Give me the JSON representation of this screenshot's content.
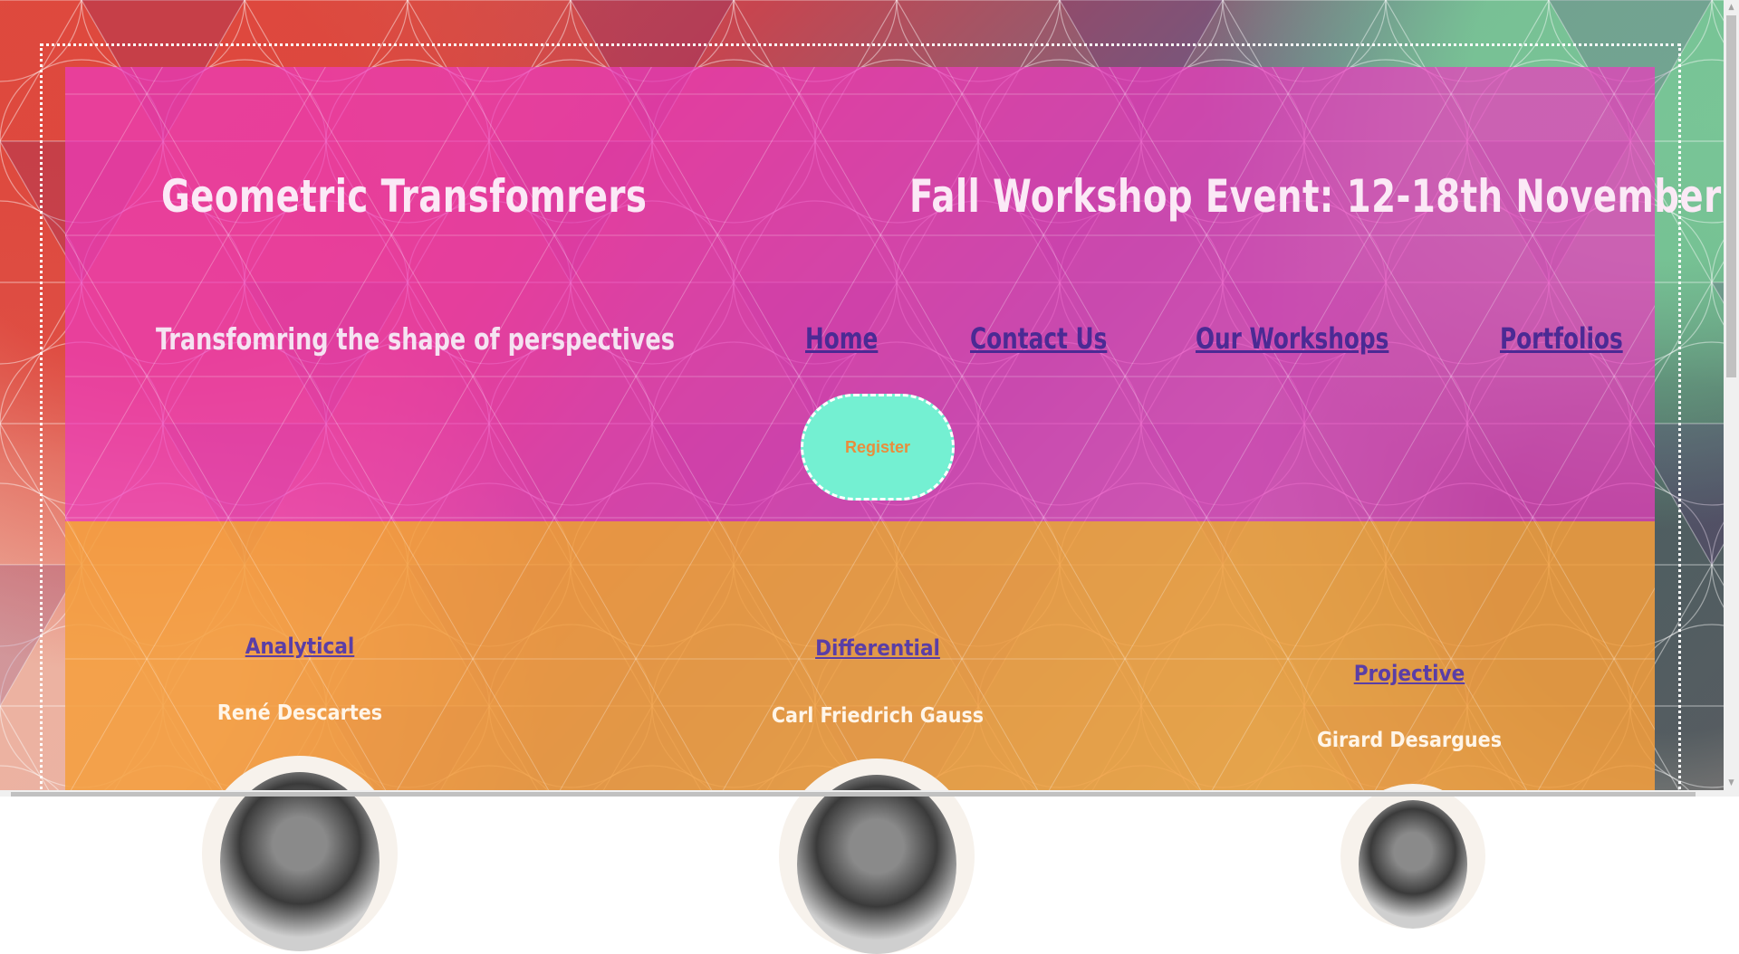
{
  "header": {
    "site_title": "Geometric Transfomrers",
    "event_title": "Fall Workshop Event: 12-18th November",
    "tagline": "Transfomring the shape of perspectives"
  },
  "nav": {
    "items": [
      {
        "label": "Home"
      },
      {
        "label": "Contact Us"
      },
      {
        "label": "Our Workshops"
      },
      {
        "label": "Portfolios"
      }
    ]
  },
  "register_button": {
    "label": "Register"
  },
  "cards": [
    {
      "link": "Analytical",
      "name": "René Descartes"
    },
    {
      "link": "Differential",
      "name": "Carl Friedrich Gauss"
    },
    {
      "link": "Projective",
      "name": "Girard Desargues"
    }
  ],
  "colors": {
    "header_overlay": "#eb3cbe",
    "section_overlay": "#f59e3c",
    "nav_link": "#4b2a94",
    "register_bg": "#74f0d2",
    "register_text": "#e98d3c"
  }
}
